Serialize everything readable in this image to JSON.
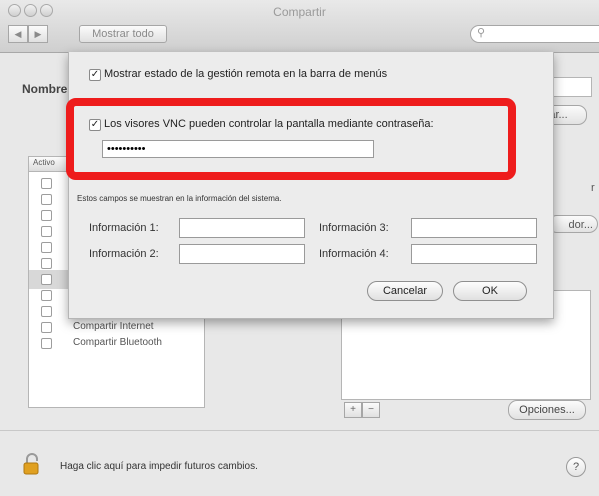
{
  "window": {
    "title": "Compartir",
    "show_all_label": "Mostrar todo",
    "back_label": "◀",
    "forward_label": "▶",
    "search_placeholder": "",
    "search_icon": "magnifier-icon"
  },
  "background": {
    "name_label": "Nombre",
    "edit_button_label": "ar...",
    "right_label_partial": "r",
    "right_button_partial": "dor...",
    "list_header": "Activo",
    "services": [
      {
        "label": "",
        "checked": false,
        "selected": false
      },
      {
        "label": "",
        "checked": false,
        "selected": false
      },
      {
        "label": "",
        "checked": false,
        "selected": false
      },
      {
        "label": "",
        "checked": false,
        "selected": false
      },
      {
        "label": "",
        "checked": false,
        "selected": false
      },
      {
        "label": "",
        "checked": false,
        "selected": false
      },
      {
        "label": "",
        "checked": false,
        "selected": true
      },
      {
        "label": "",
        "checked": false,
        "selected": false
      },
      {
        "label": "Compartir Xgrid",
        "checked": false,
        "selected": false
      },
      {
        "label": "Compartir Internet",
        "checked": false,
        "selected": false
      },
      {
        "label": "Compartir Bluetooth",
        "checked": false,
        "selected": false
      }
    ],
    "add_label": "+",
    "remove_label": "−",
    "options_label": "Opciones...",
    "lock_text": "Haga clic aquí para impedir futuros cambios.",
    "help_label": "?"
  },
  "sheet": {
    "show_status_label": "Mostrar estado de la gestión remota en la barra de menús",
    "show_status_checked": true,
    "vnc_label": "Los visores VNC pueden controlar la pantalla mediante contraseña:",
    "vnc_checked": true,
    "password_value": "••••••••••",
    "info_note": "Estos campos se muestran en la información del sistema.",
    "info_fields": [
      {
        "label": "Información 1:",
        "value": ""
      },
      {
        "label": "Información 2:",
        "value": ""
      },
      {
        "label": "Información 3:",
        "value": ""
      },
      {
        "label": "Información 4:",
        "value": ""
      }
    ],
    "cancel_label": "Cancelar",
    "ok_label": "OK"
  },
  "colors": {
    "highlight": "#ee1c1c",
    "window_bg": "#e8e8e8"
  }
}
